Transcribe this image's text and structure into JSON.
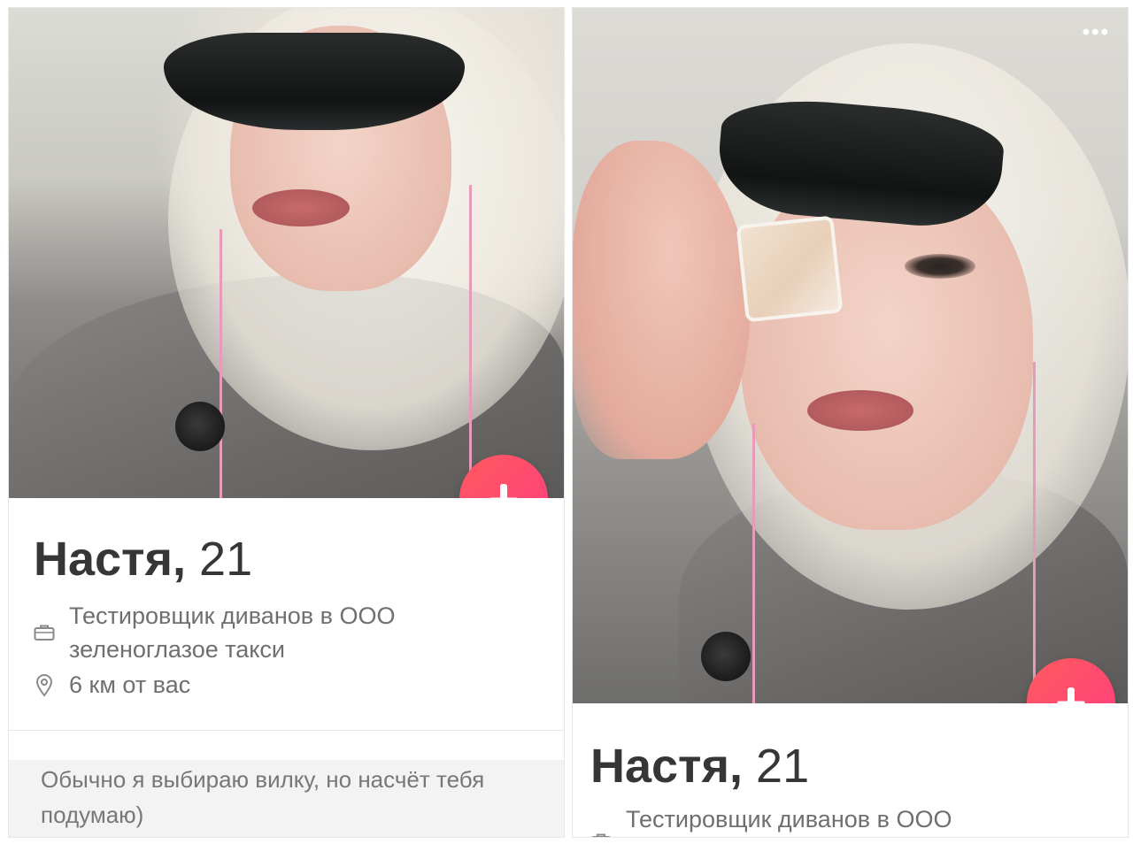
{
  "profiles": [
    {
      "name": "Настя,",
      "age": "21",
      "job": "Тестировщик диванов в ООО зеленоглазое такси",
      "distance": "6 км от вас",
      "bio": "Обычно я выбираю вилку, но насчёт тебя подумаю)",
      "icons": {
        "job": "briefcase-icon",
        "distance": "location-pin-icon",
        "action": "arrow-down-icon"
      }
    },
    {
      "name": "Настя,",
      "age": "21",
      "job": "Тестировщик диванов в ООО",
      "more": "•••",
      "icons": {
        "job": "briefcase-icon",
        "action": "arrow-down-icon",
        "more": "more-dots-icon"
      }
    }
  ],
  "colors": {
    "action_gradient_start": "#ff5a5f",
    "action_gradient_end": "#ff3d7f",
    "name_text": "#363636",
    "detail_text": "#6f6f6f",
    "bio_background": "#f3f3f3"
  }
}
